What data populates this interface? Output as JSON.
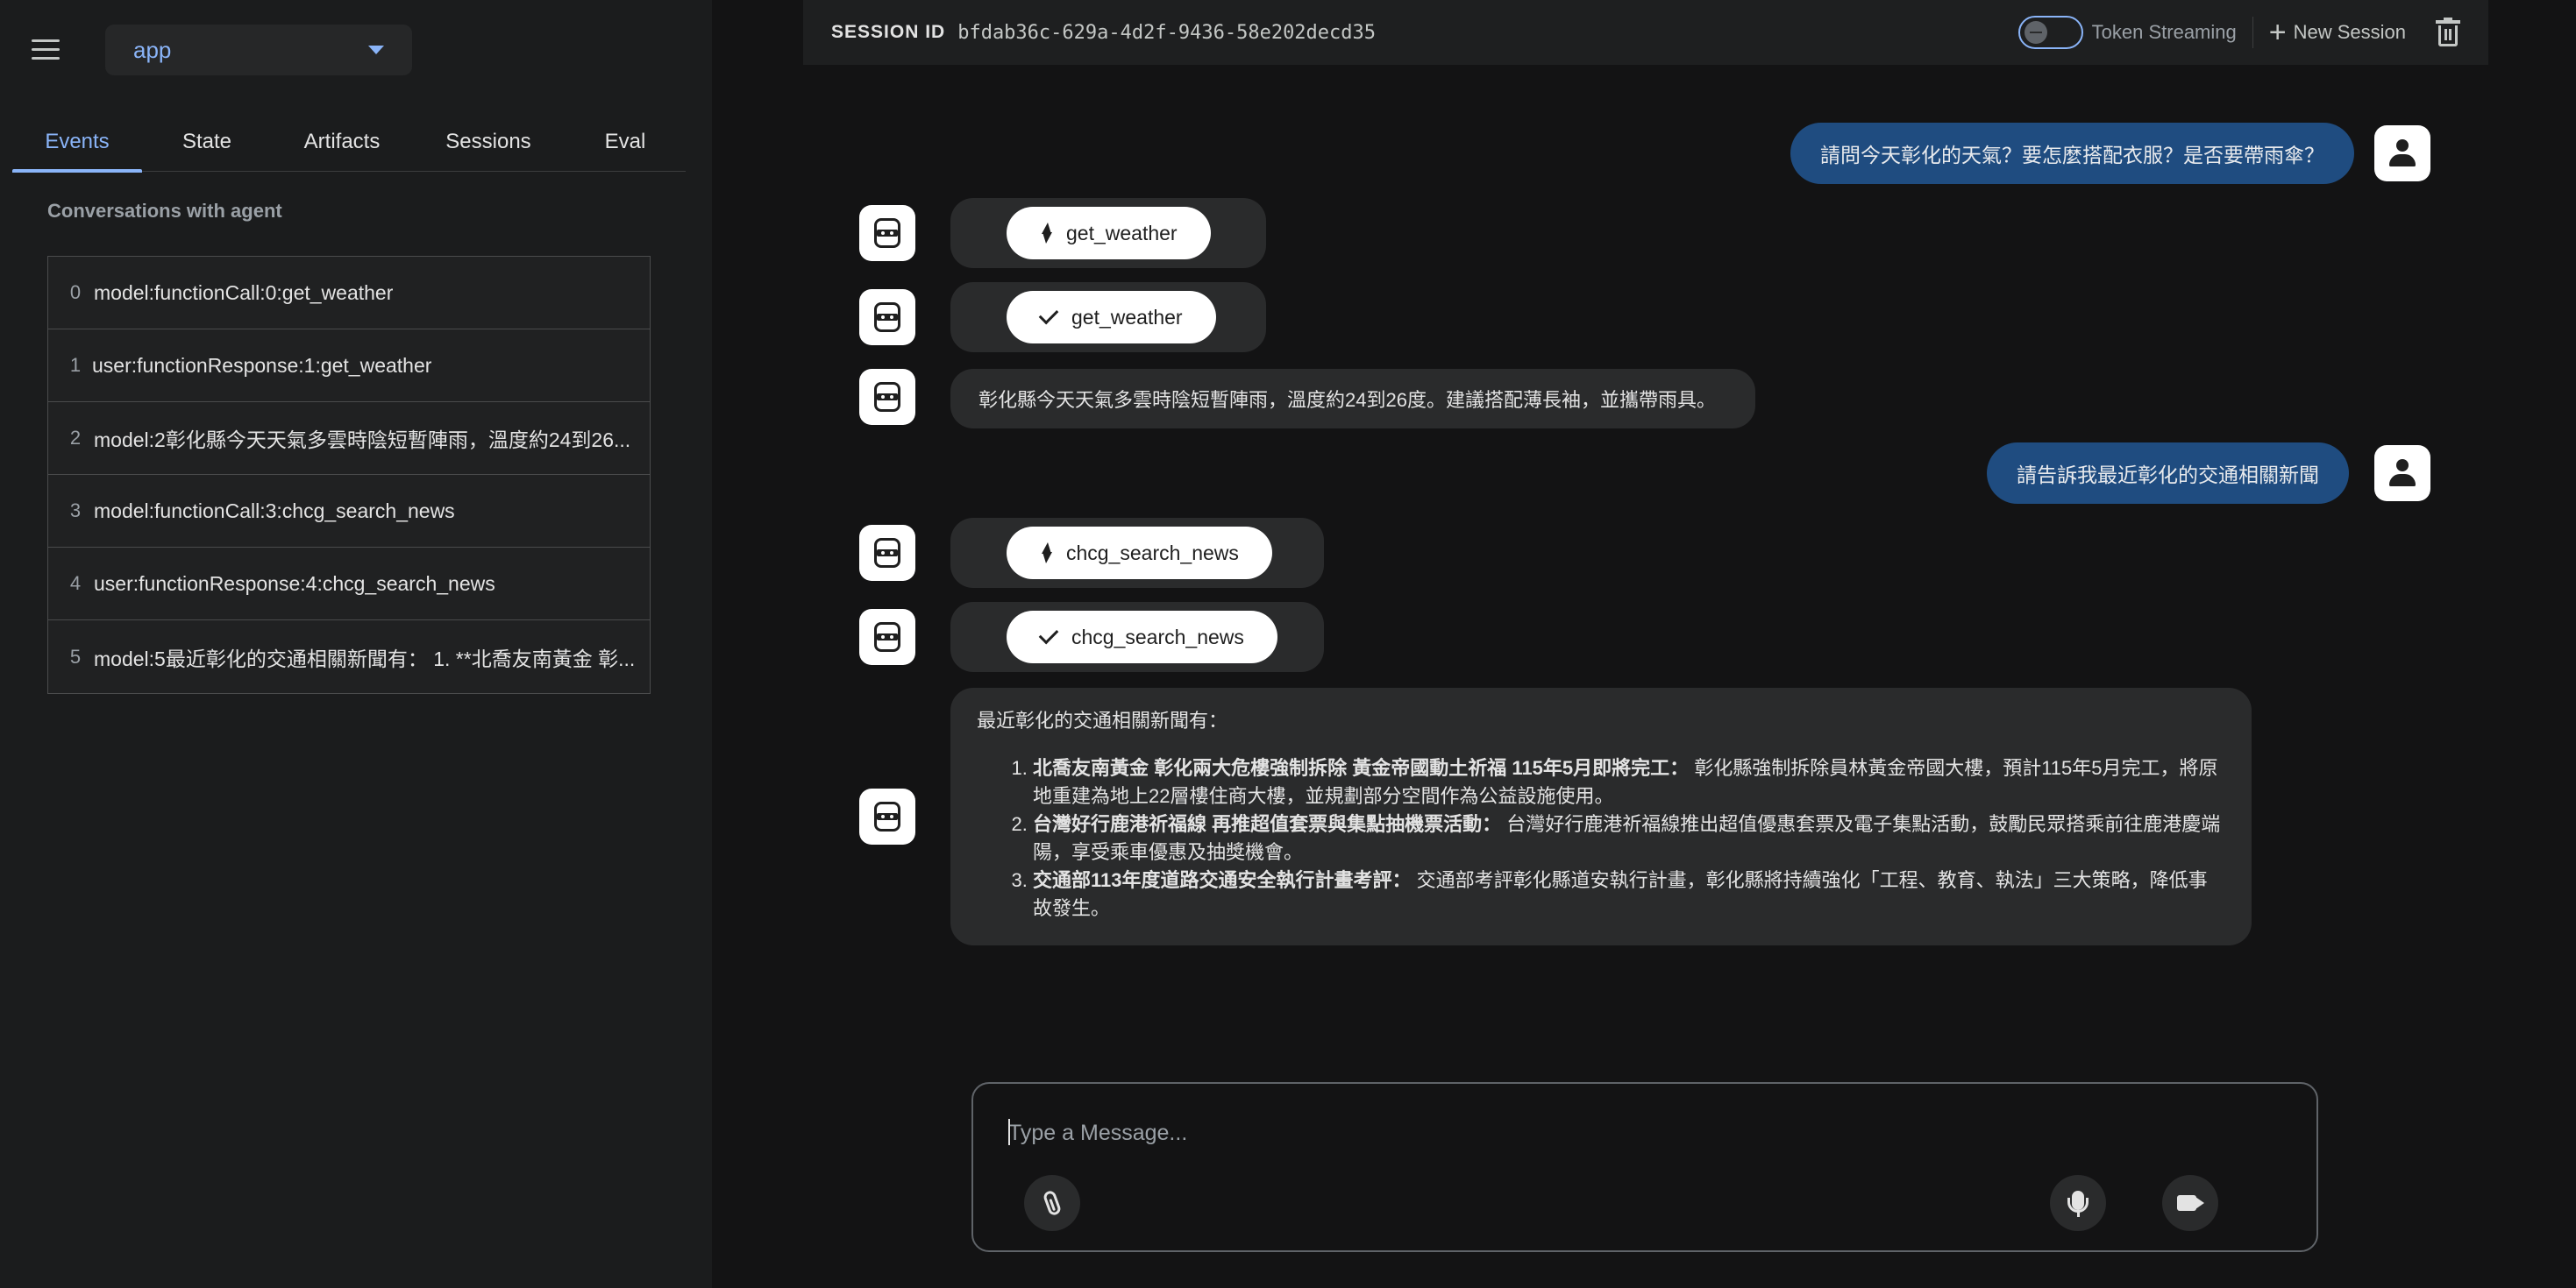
{
  "sidebar": {
    "app_name": "app",
    "tabs": [
      {
        "label": "Events",
        "active": true
      },
      {
        "label": "State",
        "active": false
      },
      {
        "label": "Artifacts",
        "active": false
      },
      {
        "label": "Sessions",
        "active": false
      },
      {
        "label": "Eval",
        "active": false
      }
    ],
    "section_title": "Conversations with agent",
    "events": [
      {
        "index": "0",
        "text": "model:functionCall:0:get_weather"
      },
      {
        "index": "1",
        "text": "user:functionResponse:1:get_weather"
      },
      {
        "index": "2",
        "text": "model:2彰化縣今天天氣多雲時陰短暫陣雨，溫度約24到26..."
      },
      {
        "index": "3",
        "text": "model:functionCall:3:chcg_search_news"
      },
      {
        "index": "4",
        "text": "user:functionResponse:4:chcg_search_news"
      },
      {
        "index": "5",
        "text": "model:5最近彰化的交通相關新聞有： 1. **北喬友南黃金 彰..."
      }
    ]
  },
  "topbar": {
    "session_label": "SESSION ID",
    "session_id": "bfdab36c-629a-4d2f-9436-58e202decd35",
    "token_streaming_label": "Token Streaming",
    "token_streaming_on": false,
    "new_session_label": "New Session"
  },
  "chat": {
    "user_message_1": "請問今天彰化的天氣？要怎麼搭配衣服？是否要帶雨傘？",
    "tool_call_1": "get_weather",
    "tool_response_1": "get_weather",
    "bot_message_1": "彰化縣今天天氣多雲時陰短暫陣雨，溫度約24到26度。建議搭配薄長袖，並攜帶雨具。",
    "user_message_2": "請告訴我最近彰化的交通相關新聞",
    "tool_call_2": "chcg_search_news",
    "tool_response_2": "chcg_search_news",
    "bot_message_2": {
      "intro": "最近彰化的交通相關新聞有：",
      "items": [
        {
          "title": "北喬友南黃金 彰化兩大危樓強制拆除 黃金帝國動土祈福 115年5月即將完工：",
          "body": " 彰化縣強制拆除員林黃金帝國大樓，預計115年5月完工，將原地重建為地上22層樓住商大樓，並規劃部分空間作為公益設施使用。"
        },
        {
          "title": "台灣好行鹿港祈福線 再推超值套票與集點抽機票活動：",
          "body": " 台灣好行鹿港祈福線推出超值優惠套票及電子集點活動，鼓勵民眾搭乘前往鹿港慶端陽，享受乘車優惠及抽獎機會。"
        },
        {
          "title": "交通部113年度道路交通安全執行計畫考評：",
          "body": " 交通部考評彰化縣道安執行計畫，彰化縣將持續強化「工程、教育、執法」三大策略，降低事故發生。"
        }
      ]
    }
  },
  "composer": {
    "placeholder": "Type a Message..."
  },
  "icons": [
    "menu-icon",
    "chevron-down-icon",
    "plus-icon",
    "trash-icon",
    "robot-icon",
    "person-icon",
    "bolt-icon",
    "check-icon",
    "paperclip-icon",
    "microphone-icon",
    "video-camera-icon"
  ],
  "colors": {
    "accent": "#8ab4f8",
    "user_bubble": "#1f4c80",
    "background": "#131314",
    "sidebar": "#1b1c1d"
  }
}
